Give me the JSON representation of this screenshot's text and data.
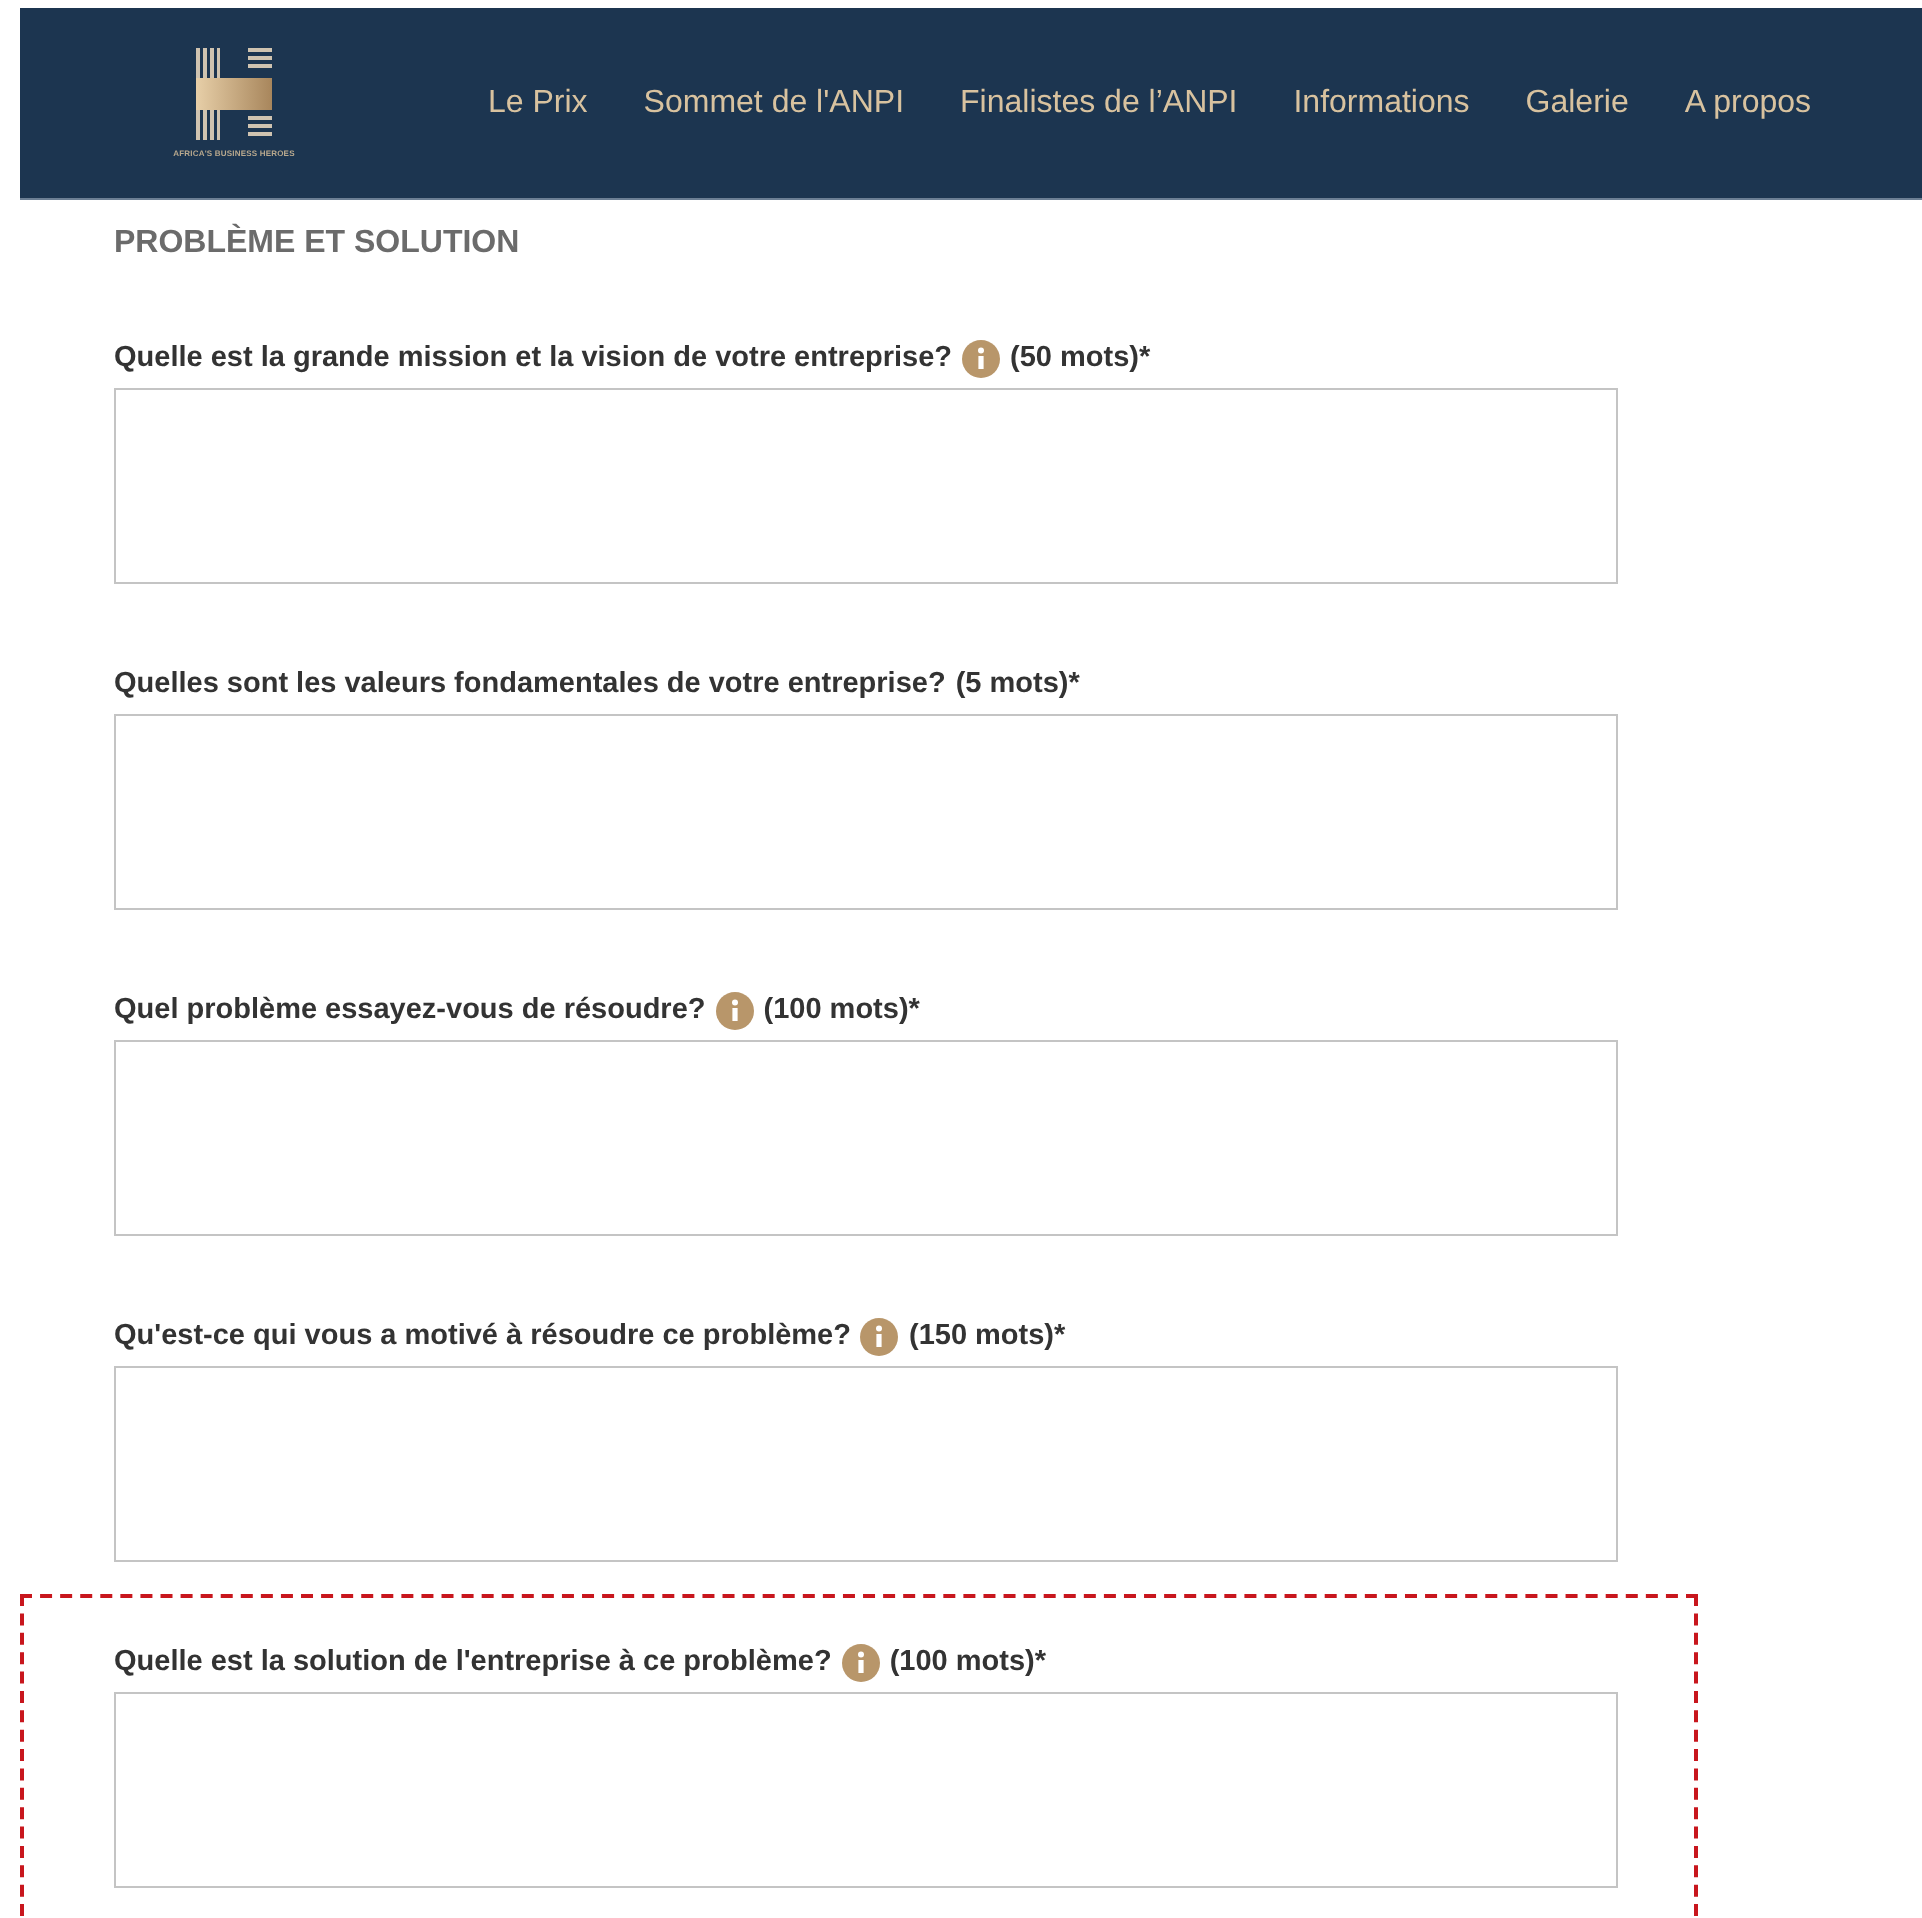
{
  "header": {
    "logo_caption": "AFRICA'S BUSINESS HEROES",
    "nav": [
      {
        "label": "Le Prix"
      },
      {
        "label": "Sommet de l'ANPI"
      },
      {
        "label": "Finalistes de l’ANPI"
      },
      {
        "label": "Informations"
      },
      {
        "label": "Galerie"
      },
      {
        "label": "A propos"
      }
    ]
  },
  "section_title": "PROBLÈME ET SOLUTION",
  "questions": [
    {
      "text": "Quelle est la grande mission et la vision de votre entreprise?",
      "info": true,
      "limit": "(50 mots)*",
      "highlighted": false
    },
    {
      "text": "Quelles sont les valeurs fondamentales de votre entreprise?",
      "info": false,
      "limit": "(5 mots)*",
      "highlighted": false
    },
    {
      "text": "Quel problème essayez-vous de résoudre?",
      "info": true,
      "limit": "(100 mots)*",
      "highlighted": false
    },
    {
      "text": "Qu'est-ce qui vous a motivé à résoudre ce problème?",
      "info": true,
      "limit": "(150 mots)*",
      "highlighted": false
    },
    {
      "text": "Quelle est la solution de l'entreprise à ce problème?",
      "info": true,
      "limit": "(100 mots)*",
      "highlighted": true
    }
  ]
}
